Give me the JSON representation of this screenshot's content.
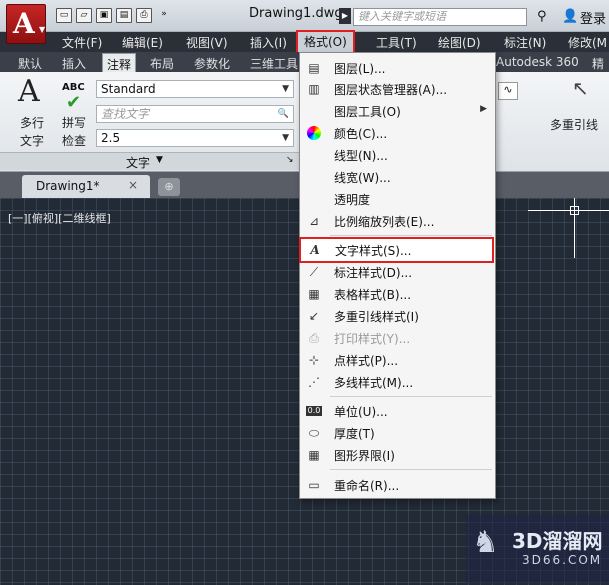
{
  "title_bar": {
    "doc_title": "Drawing1.dwg",
    "search_placeholder": "键入关键字或短语",
    "login": "登录"
  },
  "menubar": {
    "items": [
      "文件(F)",
      "编辑(E)",
      "视图(V)",
      "插入(I)",
      "格式(O)",
      "工具(T)",
      "绘图(D)",
      "标注(N)",
      "修改(M"
    ]
  },
  "ribbon_tabs": [
    "默认",
    "插入",
    "注释",
    "布局",
    "参数化",
    "三维工具",
    "Autodesk 360",
    "精选"
  ],
  "ribbon": {
    "multiline_text": "多行",
    "multiline_text2": "文字",
    "spell": "拼写",
    "spell2": "检查",
    "abc": "ABC",
    "style_value": "Standard",
    "find_placeholder": "查找文字",
    "height_value": "2.5",
    "panel_title": "文字",
    "mleader": "多重引线"
  },
  "doc_tab": {
    "label": "Drawing1*",
    "close": "×"
  },
  "viewport_label": "[一][俯视][二维线框]",
  "format_menu": {
    "items": [
      {
        "icon": "layer-icon",
        "label": "图层(L)..."
      },
      {
        "icon": "layer-state-icon",
        "label": "图层状态管理器(A)..."
      },
      {
        "icon": "",
        "label": "图层工具(O)"
      },
      {
        "icon": "color-icon",
        "label": "颜色(C)..."
      },
      {
        "icon": "",
        "label": "线型(N)..."
      },
      {
        "icon": "",
        "label": "线宽(W)..."
      },
      {
        "icon": "",
        "label": "透明度"
      },
      {
        "icon": "scale-list-icon",
        "label": "比例缩放列表(E)..."
      },
      {
        "icon": "text-style-icon",
        "label": "文字样式(S)..."
      },
      {
        "icon": "dim-style-icon",
        "label": "标注样式(D)..."
      },
      {
        "icon": "table-style-icon",
        "label": "表格样式(B)..."
      },
      {
        "icon": "mleader-style-icon",
        "label": "多重引线样式(I)"
      },
      {
        "icon": "plot-style-icon",
        "label": "打印样式(Y)..."
      },
      {
        "icon": "point-style-icon",
        "label": "点样式(P)..."
      },
      {
        "icon": "mline-style-icon",
        "label": "多线样式(M)..."
      },
      {
        "icon": "units-icon",
        "label": "单位(U)..."
      },
      {
        "icon": "thickness-icon",
        "label": "厚度(T)"
      },
      {
        "icon": "limits-icon",
        "label": "图形界限(I)"
      },
      {
        "icon": "rename-icon",
        "label": "重命名(R)..."
      }
    ]
  },
  "watermark": {
    "brand": "3D溜溜网",
    "url": "3D66.COM"
  }
}
